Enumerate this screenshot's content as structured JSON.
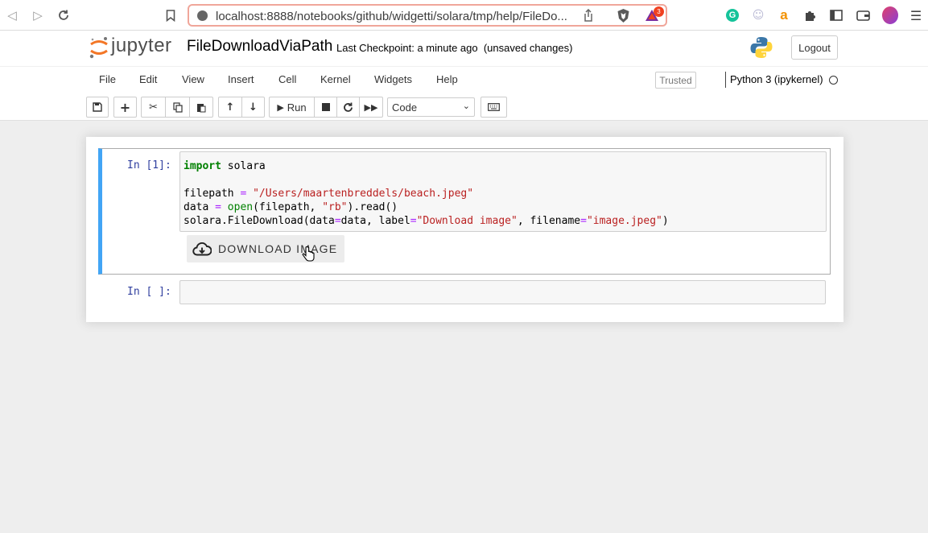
{
  "browser": {
    "url": "localhost:8888/notebooks/github/widgetti/solara/tmp/help/FileDo...",
    "shield_badge": "3"
  },
  "header": {
    "logo_text": "jupyter",
    "notebook_title": "FileDownloadViaPath",
    "checkpoint": "Last Checkpoint: a minute ago",
    "unsaved": "(unsaved changes)",
    "logout": "Logout"
  },
  "menu": {
    "items": [
      "File",
      "Edit",
      "View",
      "Insert",
      "Cell",
      "Kernel",
      "Widgets",
      "Help"
    ],
    "trusted": "Trusted",
    "kernel": "Python 3 (ipykernel)"
  },
  "toolbar": {
    "run_label": "Run",
    "cell_type": "Code"
  },
  "cells": [
    {
      "prompt": "In [1]:",
      "code": [
        "import solara",
        "",
        "filepath = \"/Users/maartenbreddels/beach.jpeg\"",
        "data = open(filepath, \"rb\").read()",
        "solara.FileDownload(data=data, label=\"Download image\", filename=\"image.jpeg\")"
      ],
      "output_button": "DOWNLOAD IMAGE"
    },
    {
      "prompt": "In [ ]:"
    }
  ],
  "colors": {
    "selected_cell_bar": "#42a5f5",
    "prompt": "#303f9f",
    "jupyter_orange": "#f37626"
  }
}
